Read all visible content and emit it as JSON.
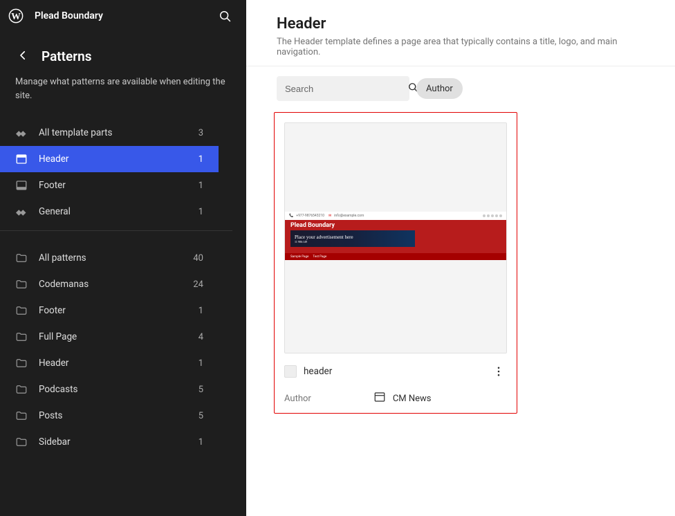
{
  "site": {
    "title": "Plead Boundary"
  },
  "page": {
    "title": "Patterns",
    "description": "Manage what patterns are available when editing the site."
  },
  "templateParts": [
    {
      "icon": "diamond",
      "label": "All template parts",
      "count": "3",
      "active": false
    },
    {
      "icon": "header",
      "label": "Header",
      "count": "1",
      "active": true
    },
    {
      "icon": "footer",
      "label": "Footer",
      "count": "1",
      "active": false
    },
    {
      "icon": "diamond",
      "label": "General",
      "count": "1",
      "active": false
    }
  ],
  "patternFolders": [
    {
      "label": "All patterns",
      "count": "40"
    },
    {
      "label": "Codemanas",
      "count": "24"
    },
    {
      "label": "Footer",
      "count": "1"
    },
    {
      "label": "Full Page",
      "count": "4"
    },
    {
      "label": "Header",
      "count": "1"
    },
    {
      "label": "Podcasts",
      "count": "5"
    },
    {
      "label": "Posts",
      "count": "5"
    },
    {
      "label": "Sidebar",
      "count": "1"
    }
  ],
  "main": {
    "header": {
      "title": "Header",
      "description": "The Header template defines a page area that typically contains a title, logo, and main navigation."
    },
    "search": {
      "placeholder": "Search"
    },
    "authorFilter": {
      "label": "Author"
    },
    "card": {
      "name": "header",
      "authorLabel": "Author",
      "author": "CM News",
      "preview": {
        "contactPhone": "+977-9876543210",
        "contactEmail": "info@example.com",
        "siteTitle": "Plead Boundary",
        "adText": "Place your advertisement here",
        "adPhone": "11 986:149",
        "nav1": "Sample Page",
        "nav2": "Test Page"
      }
    }
  }
}
